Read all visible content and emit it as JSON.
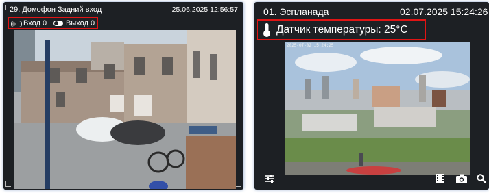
{
  "camera1": {
    "title": "29. Домофон Задний вход",
    "timestamp": "25.06.2025 12:56:57",
    "entry_label": "Вход 0",
    "exit_label": "Выход 0"
  },
  "camera2": {
    "title": "01. Эспланада",
    "timestamp": "02.07.2025 15:24:26",
    "overlay_timestamp": "2025-07-02 15:24:25",
    "temperature_label": "Датчик температуры: 25°C"
  },
  "icons": {
    "settings": "sliders-icon",
    "archive": "film-icon",
    "snapshot": "camera-icon",
    "zoom": "magnifier-icon",
    "thermometer": "thermometer-icon",
    "toggle": "toggle-icon"
  },
  "colors": {
    "tile_bg": "#1d2024",
    "highlight": "#e01414",
    "text": "#ffffff"
  }
}
